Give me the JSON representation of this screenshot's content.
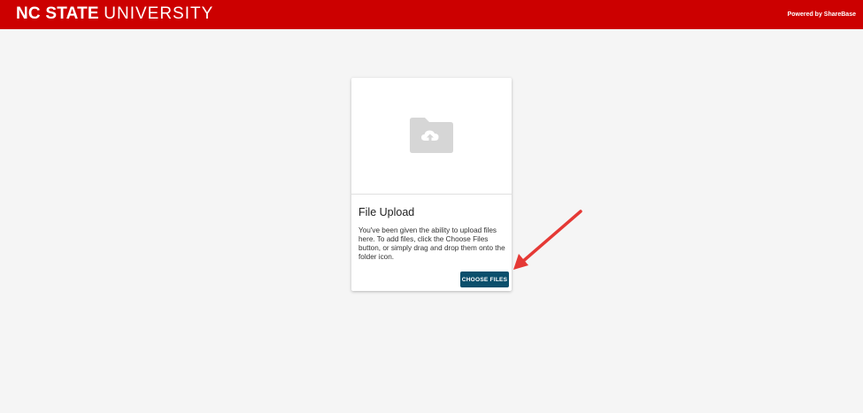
{
  "header": {
    "logo_bold": "NC STATE",
    "logo_light": "UNIVERSITY",
    "powered_by": "Powered by ShareBase",
    "brand_color": "#cc0000"
  },
  "upload_card": {
    "icon": "folder-upload-icon",
    "title": "File Upload",
    "description": "You've been given the ability to upload files here. To add files, click the Choose Files button, or simply drag and drop them onto the folder icon.",
    "choose_files_label": "CHOOSE FILES",
    "button_color": "#0b4f6c"
  },
  "annotation": {
    "icon": "red-arrow-icon",
    "color": "#e53935"
  }
}
